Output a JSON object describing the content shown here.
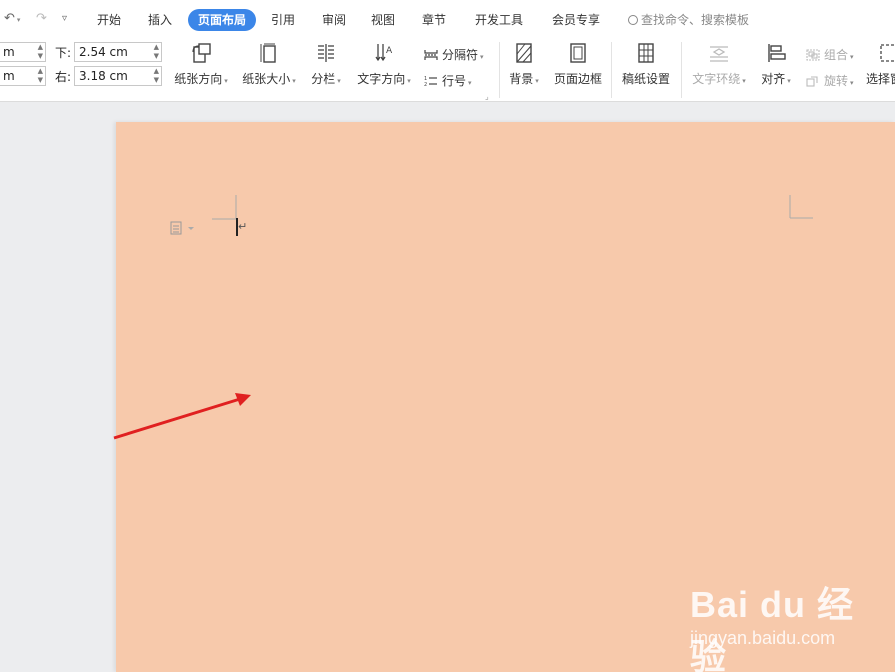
{
  "quick_access": {
    "undo_icon": "undo-icon",
    "redo_icon": "redo-icon",
    "customize_icon": "customize-dropdown-icon"
  },
  "tabs": [
    {
      "label": "开始",
      "active": false
    },
    {
      "label": "插入",
      "active": false
    },
    {
      "label": "页面布局",
      "active": true
    },
    {
      "label": "引用",
      "active": false
    },
    {
      "label": "审阅",
      "active": false
    },
    {
      "label": "视图",
      "active": false
    },
    {
      "label": "章节",
      "active": false
    },
    {
      "label": "开发工具",
      "active": false
    },
    {
      "label": "会员专享",
      "active": false
    }
  ],
  "search": {
    "placeholder": "查找命令、搜索模板"
  },
  "margins": {
    "top_left_value": "m",
    "bottom_left_value": "m",
    "bottom_label": "下:",
    "bottom_value": "2.54 cm",
    "right_label": "右:",
    "right_value": "3.18 cm"
  },
  "ribbon": {
    "orientation": "纸张方向",
    "size": "纸张大小",
    "columns": "分栏",
    "text_direction": "文字方向",
    "breaks": "分隔符",
    "line_numbers": "行号",
    "background": "背景",
    "page_border": "页面边框",
    "manuscript": "稿纸设置",
    "text_wrap": "文字环绕",
    "align": "对齐",
    "group": "组合",
    "rotate": "旋转",
    "selection_pane": "选择窗"
  },
  "document": {
    "page_color": "#f7c9ab",
    "paragraph_mark": "↵"
  },
  "annotation": {
    "color": "#e02020"
  },
  "watermark": {
    "brand": "Bai du 经验",
    "url": "jingyan.baidu.com"
  }
}
